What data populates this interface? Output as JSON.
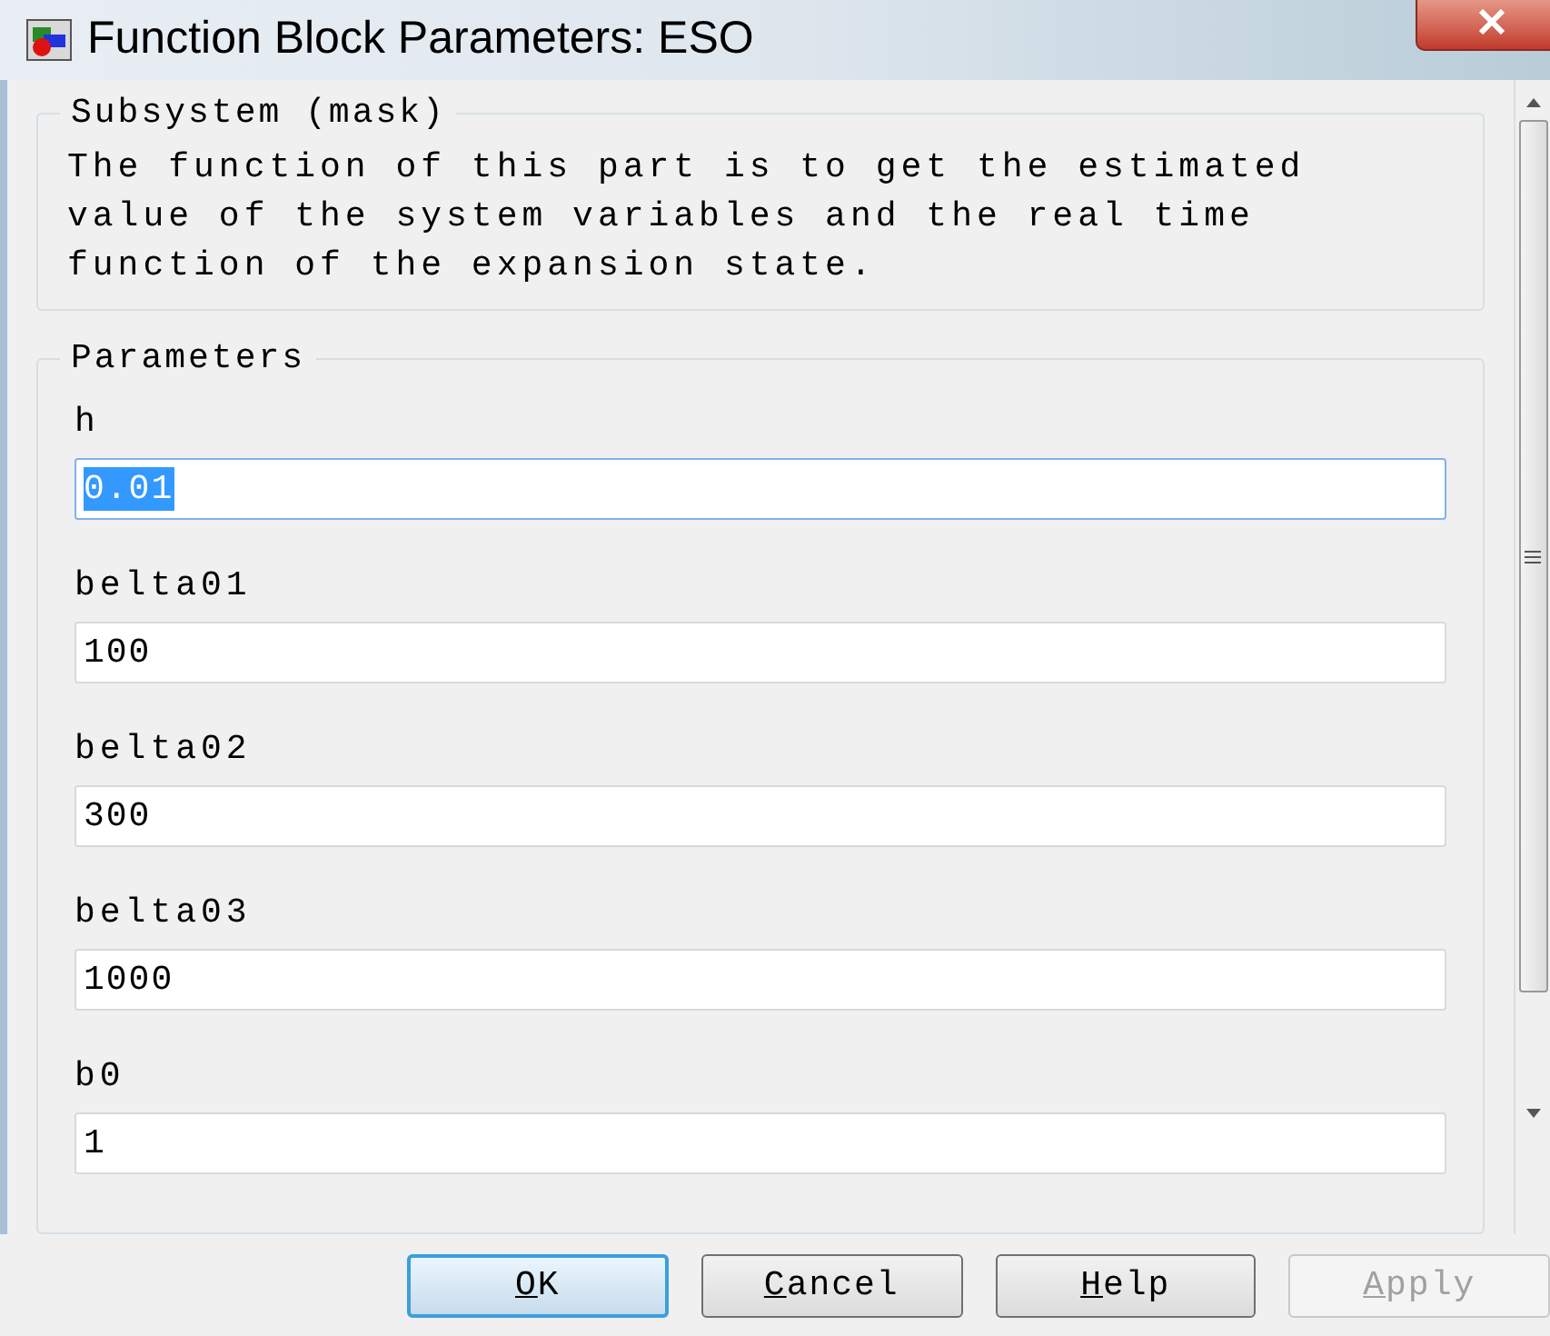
{
  "window": {
    "title": "Function Block Parameters: ESO"
  },
  "description_group": {
    "title": "Subsystem (mask)",
    "text": "The function of this part is to get the estimated value of the system variables and the real time function of the expansion state."
  },
  "parameters_group": {
    "title": "Parameters",
    "fields": [
      {
        "label": "h",
        "value": "0.01",
        "selected": true
      },
      {
        "label": "belta01",
        "value": "100",
        "selected": false
      },
      {
        "label": "belta02",
        "value": "300",
        "selected": false
      },
      {
        "label": "belta03",
        "value": "1000",
        "selected": false
      },
      {
        "label": "b0",
        "value": "1",
        "selected": false
      }
    ]
  },
  "buttons": [
    {
      "label": "OK",
      "default": true,
      "disabled": false
    },
    {
      "label": "Cancel",
      "default": false,
      "disabled": false
    },
    {
      "label": "Help",
      "default": false,
      "disabled": false
    },
    {
      "label": "Apply",
      "default": false,
      "disabled": true
    }
  ]
}
